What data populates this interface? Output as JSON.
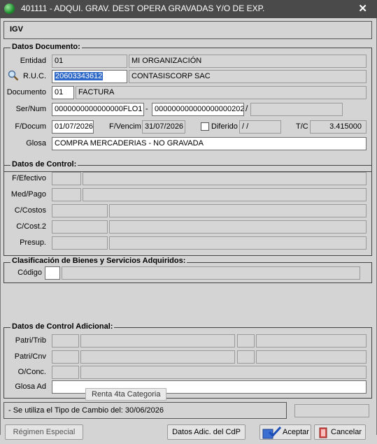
{
  "window": {
    "title": "401111 - ADQUI. GRAV. DEST OPERA GRAVADAS Y/O DE EXP.",
    "close_glyph": "✕"
  },
  "header": {
    "label": "IGV"
  },
  "datos_documento": {
    "legend": "Datos Documento:",
    "entidad_label": "Entidad",
    "entidad_code": "01",
    "entidad_name": "MI ORGANIZACIÓN",
    "ruc_label": "R.U.C.",
    "ruc_value": "20603343612",
    "ruc_name": "CONTASISCORP SAC",
    "documento_label": "Documento",
    "documento_code": "01",
    "documento_name": "FACTURA",
    "sernum_label": "Ser/Num",
    "serie": "0000000000000000FLO1",
    "dash": "-",
    "numero": "000000000000000000202",
    "slash": "/",
    "fdocum_label": "F/Docum",
    "fdocum_value": "01/07/2026",
    "fvencim_label": "F/Vencim",
    "fvencim_value": "31/07/2026",
    "diferido_label": "Diferido",
    "diferido_value": "/  /",
    "tc_label": "T/C",
    "tc_value": "3.415000",
    "glosa_label": "Glosa",
    "glosa_value": "COMPRA MERCADERIAS - NO GRAVADA"
  },
  "datos_control": {
    "legend": "Datos de Control:",
    "fefectivo_label": "F/Efectivo",
    "medpago_label": "Med/Pago",
    "ccostos_label": "C/Costos",
    "ccost2_label": "C/Cost.2",
    "presup_label": "Presup."
  },
  "clasificacion": {
    "legend": "Clasificación de Bienes y Servicios Adquiridos:",
    "codigo_label": "Código"
  },
  "control_adicional": {
    "legend": "Datos de Control Adicional:",
    "patritrib_label": "Patri/Trib",
    "patricnv_label": "Patri/Cnv",
    "oconc_label": "O/Conc.",
    "glosaad_label": "Glosa Ad",
    "tooltip": "Renta 4ta Categoria"
  },
  "status": {
    "message": "- Se utiliza el Tipo de Cambio del: 30/06/2026"
  },
  "buttons": {
    "regimen": "Régimen Especial",
    "datos_adic": "Datos Adic. del CdP",
    "aceptar": "Aceptar",
    "cancelar": "Cancelar"
  }
}
